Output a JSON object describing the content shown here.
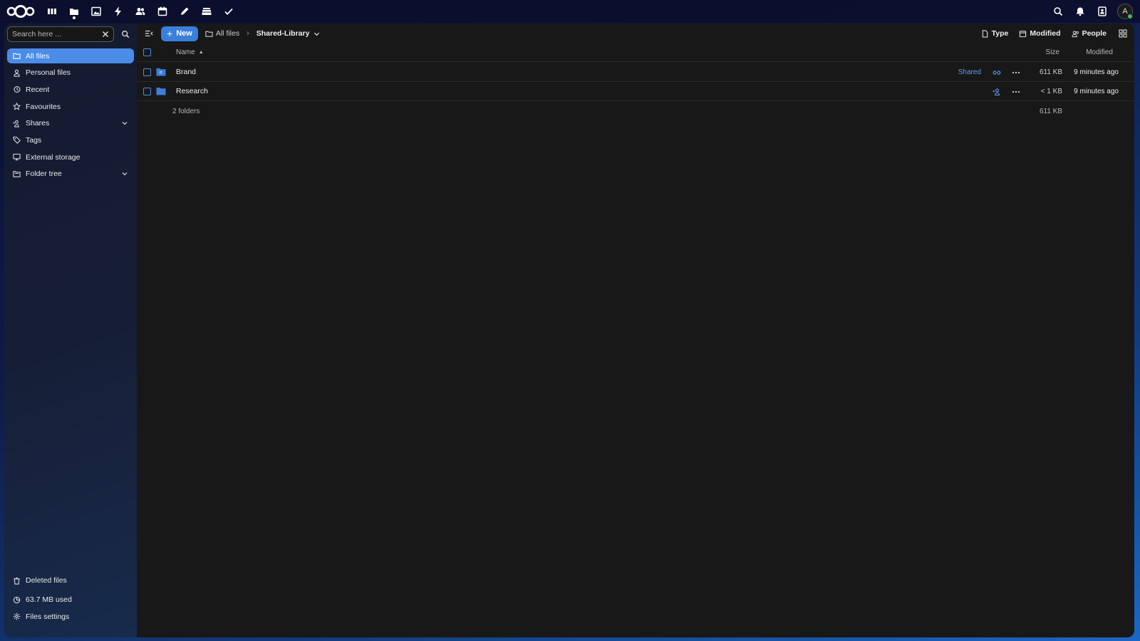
{
  "header": {
    "apps": [
      {
        "name": "dashboard-icon"
      },
      {
        "name": "files-icon",
        "active": true
      },
      {
        "name": "photos-icon"
      },
      {
        "name": "activity-icon"
      },
      {
        "name": "contacts-icon"
      },
      {
        "name": "calendar-icon"
      },
      {
        "name": "notes-icon"
      },
      {
        "name": "deck-icon"
      },
      {
        "name": "tasks-icon"
      }
    ],
    "avatar_initial": "A"
  },
  "sidebar": {
    "search": {
      "placeholder": "Search here ...",
      "value": ""
    },
    "items": [
      {
        "label": "All files",
        "icon": "folder-icon",
        "active": true
      },
      {
        "label": "Personal files",
        "icon": "person-icon"
      },
      {
        "label": "Recent",
        "icon": "history-icon"
      },
      {
        "label": "Favourites",
        "icon": "star-icon"
      },
      {
        "label": "Shares",
        "icon": "share-icon",
        "expandable": true
      },
      {
        "label": "Tags",
        "icon": "tag-icon"
      },
      {
        "label": "External storage",
        "icon": "external-storage-icon"
      },
      {
        "label": "Folder tree",
        "icon": "folder-tree-icon",
        "expandable": true
      }
    ],
    "bottom": {
      "deleted": "Deleted files",
      "quota": "63.7 MB used",
      "settings": "Files settings"
    }
  },
  "toolbar": {
    "new_label": "New",
    "breadcrumb_root": "All files",
    "breadcrumb_current": "Shared-Library",
    "filters": {
      "type": "Type",
      "modified": "Modified",
      "people": "People"
    }
  },
  "table": {
    "headers": {
      "name": "Name",
      "size": "Size",
      "modified": "Modified"
    },
    "rows": [
      {
        "name": "Brand",
        "shared_label": "Shared",
        "size": "611 KB",
        "modified": "9 minutes ago"
      },
      {
        "name": "Research",
        "shared_label": "",
        "size": "< 1 KB",
        "modified": "9 minutes ago"
      }
    ],
    "summary": {
      "count": "2 folders",
      "total_size": "611 KB"
    }
  },
  "colors": {
    "accent": "#4a8ce8",
    "link": "#5b9cf0",
    "background": "#181818"
  }
}
